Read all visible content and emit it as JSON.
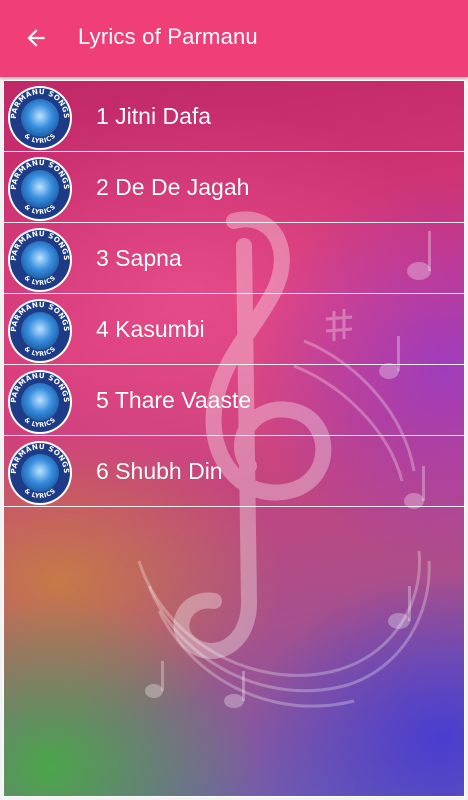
{
  "appbar": {
    "title": "Lyrics of Parmanu",
    "background_color": "#ef3f76",
    "back_icon": "arrow-back-icon"
  },
  "badge": {
    "top_text": "PARMANU SONGS",
    "bottom_text": "& LYRICS",
    "icon": "album-badge-icon",
    "ring_color": "#1d3b86",
    "center_color": "#3a8fdf"
  },
  "songs": [
    {
      "label": "1 Jitni Dafa"
    },
    {
      "label": "2 De De Jagah"
    },
    {
      "label": "3 Sapna"
    },
    {
      "label": "4 Kasumbi"
    },
    {
      "label": "5 Thare Vaaste"
    },
    {
      "label": "6 Shubh Din"
    }
  ]
}
